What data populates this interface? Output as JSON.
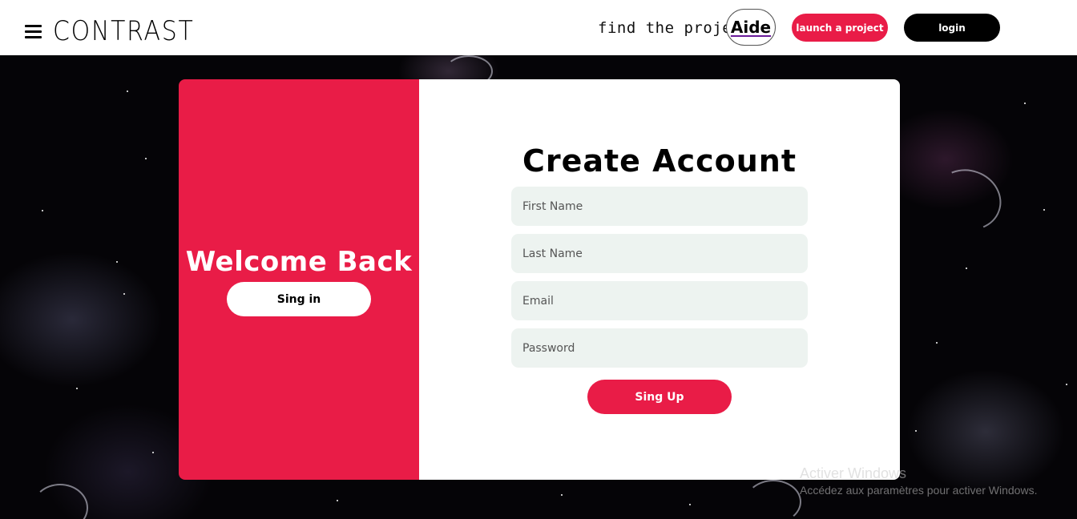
{
  "header": {
    "logo_text": "CONTRAST",
    "find_projects_label": "find the projects",
    "aide_label": "Aide",
    "launch_label": "launch a project",
    "login_label": "login"
  },
  "signin_panel": {
    "title": "Welcome Back",
    "signin_label": "Sing in"
  },
  "signup_form": {
    "title": "Create Account",
    "first_name_placeholder": "First Name",
    "last_name_placeholder": "Last Name",
    "email_placeholder": "Email",
    "password_placeholder": "Password",
    "signup_label": "Sing Up"
  },
  "watermark": {
    "title": "Activer Windows",
    "subtitle": "Accédez aux paramètres pour activer Windows."
  },
  "colors": {
    "accent": "#e91c47",
    "input_bg": "#edf3f0",
    "header_bg": "#ffffff"
  }
}
